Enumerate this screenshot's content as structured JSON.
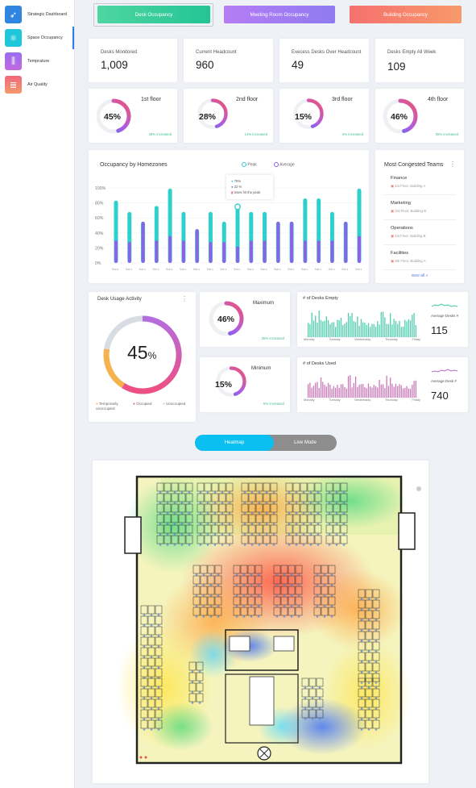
{
  "sidebar": {
    "items": [
      {
        "label": "Strategic Dashboard",
        "icon": "rocket-icon",
        "color": "#2f86e0",
        "active": false
      },
      {
        "label": "Space Occupancy",
        "icon": "atom-icon",
        "color": "#20c6d9",
        "active": true
      },
      {
        "label": "Temprature",
        "icon": "sliders-icon",
        "color": "#9a6cf0",
        "active": false
      },
      {
        "label": "Air Quality",
        "icon": "database-icon",
        "color": "#f0677c",
        "active": false
      }
    ]
  },
  "tabs": [
    "Desk Occupancy",
    "Meeting Room Occupancy",
    "Building Occupancy"
  ],
  "stats": [
    {
      "label": "Desks Monitored",
      "value": "1,009"
    },
    {
      "label": "Current Headcount",
      "value": "960"
    },
    {
      "label": "Execess Desks Over Headcount",
      "value": "49"
    },
    {
      "label": "Desks Empty All Week",
      "value": "109"
    }
  ],
  "floors": [
    {
      "name": "1st floor",
      "pct": "45%",
      "fraction": 0.45,
      "increase": "28% increased"
    },
    {
      "name": "2nd floor",
      "pct": "28%",
      "fraction": 0.28,
      "increase": "14% increased"
    },
    {
      "name": "3rd floor",
      "pct": "15%",
      "fraction": 0.15,
      "increase": "5% increased"
    },
    {
      "name": "4th floor",
      "pct": "46%",
      "fraction": 0.46,
      "increase": "35% increased"
    }
  ],
  "homezones": {
    "title": "Occupancy by Homezones",
    "legend_peak": "Peak",
    "legend_average": "Average",
    "tooltip": {
      "peak": "75%",
      "average": "22 %",
      "note": "times hit the peak"
    },
    "yticks": [
      "100%",
      "80%",
      "60%",
      "40%",
      "20%",
      "0%"
    ],
    "xlabel": "Sub s"
  },
  "chart_data": {
    "type": "bar",
    "categories": [
      "1",
      "2",
      "3",
      "4",
      "5",
      "6",
      "7",
      "8",
      "9",
      "10",
      "11",
      "12",
      "13",
      "14",
      "15",
      "16",
      "17",
      "18",
      "19",
      "20"
    ],
    "series": [
      {
        "name": "Peak",
        "values": [
          83,
          68,
          55,
          76,
          99,
          68,
          45,
          68,
          55,
          75,
          68,
          68,
          55,
          55,
          86,
          86,
          68,
          55,
          99,
          0
        ]
      },
      {
        "name": "Average",
        "values": [
          30,
          28,
          55,
          30,
          36,
          30,
          45,
          28,
          28,
          22,
          30,
          30,
          55,
          55,
          30,
          30,
          30,
          55,
          36,
          0
        ]
      }
    ],
    "ylim": [
      0,
      100
    ]
  },
  "teams": {
    "title": "Most Congested Teams",
    "items": [
      {
        "name": "Finance",
        "loc": "1st Floor, Building A"
      },
      {
        "name": "Marketing",
        "loc": "3rd Floor, Building B"
      },
      {
        "name": "Operations",
        "loc": "1st Floor, Building B"
      },
      {
        "name": "Facilities",
        "loc": "9th Floor, Building A"
      }
    ],
    "view_all": "view all »"
  },
  "usage": {
    "title": "Desk Usage Activity",
    "pct": "45",
    "pct_sign": "%",
    "legend": [
      {
        "label": "Temporarily unoccupied",
        "color": "#f5b24d"
      },
      {
        "label": "Occupied",
        "color": "#e94c7e"
      },
      {
        "label": "Unoccupied",
        "color": "#c8ccd4"
      }
    ]
  },
  "maximum": {
    "title": "Maximum",
    "pct": "46%",
    "fraction": 0.46,
    "increase": "35% increased"
  },
  "minimum": {
    "title": "Minimum",
    "pct": "15%",
    "fraction": 0.15,
    "increase": "5% increased"
  },
  "desks_empty": {
    "title": "# of Desks Empty",
    "days": [
      "Monday",
      "Tuesday",
      "Wednesday",
      "Thursday",
      "Friday"
    ],
    "avg_label": "Average Desks #",
    "avg_value": "115",
    "ymax": "120"
  },
  "desks_used": {
    "title": "# of Desks Used",
    "days": [
      "Monday",
      "Tuesday",
      "Wednesday",
      "Thursday",
      "Friday"
    ],
    "avg_label": "Average Desk #",
    "avg_value": "740",
    "ymax": "500"
  },
  "toggle": {
    "on": "Heatmap",
    "off": "Live Mode"
  }
}
